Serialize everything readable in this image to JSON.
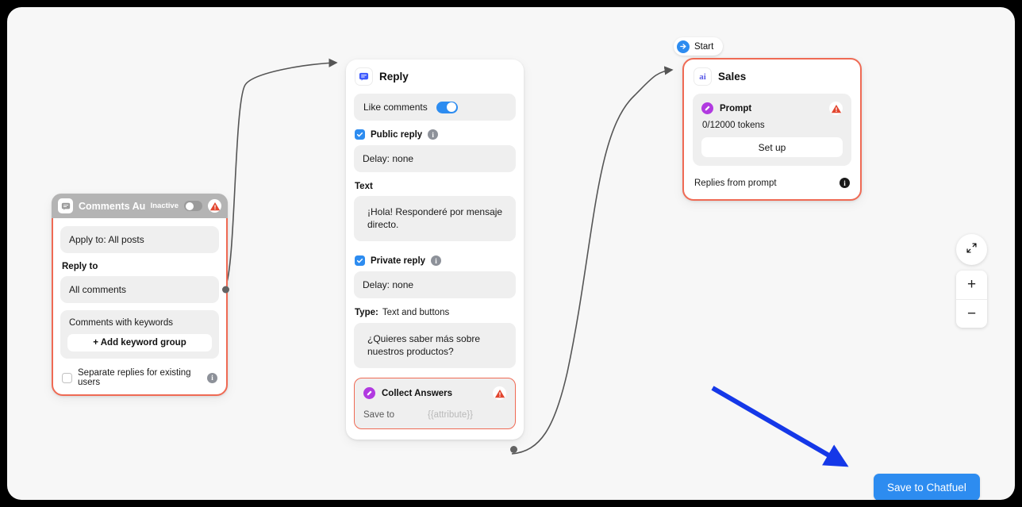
{
  "canvas": {
    "background_color": "#f7f7f7",
    "accent_color": "#2d8cf0",
    "error_color": "#ef6a54"
  },
  "start_badge": {
    "label": "Start",
    "icon": "arrow-right-circle-icon"
  },
  "nodes": {
    "comments_automation": {
      "title": "Comments Auto...",
      "state_label": "Inactive",
      "icon": "comment-bubble-icon",
      "apply_to": "Apply to: All posts",
      "reply_to_label": "Reply to",
      "reply_to_value": "All comments",
      "keywords_label": "Comments with keywords",
      "add_keyword_button": "+ Add keyword group",
      "separate_replies_label": "Separate replies for existing users",
      "separate_replies_checked": false
    },
    "reply": {
      "title": "Reply",
      "icon": "comment-bubble-icon",
      "like_comments_label": "Like comments",
      "like_comments_on": true,
      "public_reply_label": "Public reply",
      "public_reply_checked": true,
      "public_delay": "Delay: none",
      "text_label": "Text",
      "public_message": "¡Hola! Responderé por mensaje directo.",
      "private_reply_label": "Private reply",
      "private_reply_checked": true,
      "private_delay": "Delay: none",
      "type_key": "Type:",
      "type_value": "Text and buttons",
      "private_message": "¿Quieres saber más sobre nuestros productos?",
      "collect_answers": {
        "title": "Collect Answers",
        "save_to_label": "Save to",
        "save_to_value": "{{attribute}}"
      }
    },
    "sales": {
      "title": "Sales",
      "icon": "ai-icon",
      "prompt_title": "Prompt",
      "tokens": "0/12000 tokens",
      "setup_button": "Set up",
      "replies_label": "Replies from prompt"
    }
  },
  "controls": {
    "fit_icon": "fit-to-screen-icon",
    "zoom_in": "+",
    "zoom_out": "−"
  },
  "save_button": {
    "label": "Save to Chatfuel"
  }
}
